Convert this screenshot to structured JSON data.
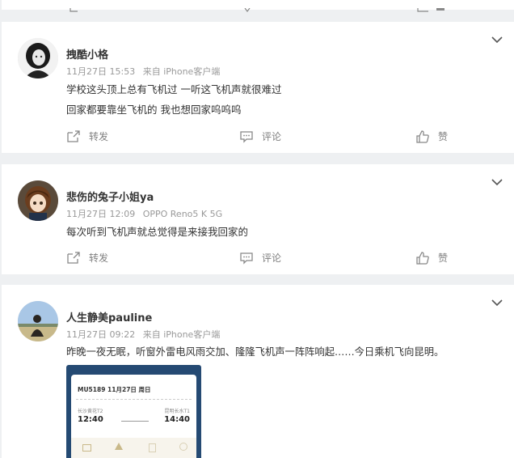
{
  "actions": {
    "forward_label": "转发",
    "comment_label": "评论",
    "like_label": "赞"
  },
  "posts": [
    {
      "username": "拽酷小格",
      "time": "11月27日 15:53",
      "source": "来自 iPhone客户端",
      "lines": [
        "学校这头顶上总有飞机过 一听这飞机声就很难过",
        "回家都要靠坐飞机的 我也想回家呜呜呜"
      ]
    },
    {
      "username": "悲伤的兔子小姐ya",
      "time": "11月27日 12:09",
      "source": "OPPO Reno5 K 5G",
      "lines": [
        "每次听到飞机声就总觉得是来接我回家的"
      ]
    },
    {
      "username": "人生静美pauline",
      "time": "11月27日 09:22",
      "source": "来自 iPhone客户端",
      "lines": [
        "昨晚一夜无眠，听窗外雷电风雨交加、隆隆飞机声一阵阵响起……今日乘机飞向昆明。"
      ],
      "ticket": {
        "flight": "MU5189  11月27日  周日",
        "from_label": "长沙黄花T2",
        "from_time": "12:40",
        "to_label": "昆明长水T1",
        "to_time": "14:40"
      }
    }
  ],
  "colors": {
    "background": "#eef0f2",
    "card": "#ffffff",
    "meta": "#999999",
    "action": "#808080",
    "ticket_bg": "#254a73"
  }
}
